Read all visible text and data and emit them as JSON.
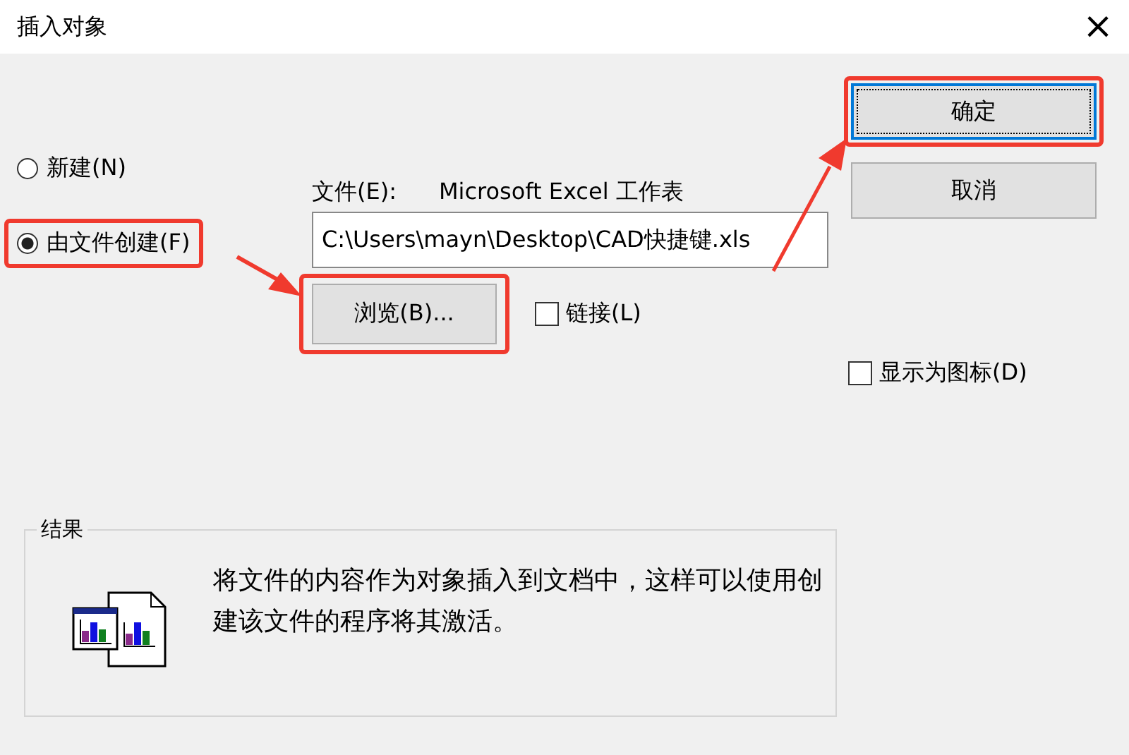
{
  "window": {
    "title": "插入对象",
    "close": "×"
  },
  "options": [
    {
      "label": "新建(N)",
      "selected": false,
      "highlighted": false
    },
    {
      "label": "由文件创建(F)",
      "selected": true,
      "highlighted": true
    }
  ],
  "file": {
    "label": "文件(E):",
    "type": "Microsoft Excel 工作表",
    "value": "C:\\Users\\mayn\\Desktop\\CAD快捷键.xls"
  },
  "browse": {
    "label": "浏览(B)...",
    "highlighted": true
  },
  "link": {
    "label": "链接(L)",
    "checked": false
  },
  "buttons": [
    {
      "label": "确定",
      "default": true,
      "highlighted": true
    },
    {
      "label": "取消",
      "default": false,
      "highlighted": false
    }
  ],
  "display_as_icon": {
    "label": "显示为图标(D)",
    "checked": false
  },
  "result": {
    "title": "结果",
    "text": "将文件的内容作为对象插入到文档中，这样可以使用创建该文件的程序将其激活。"
  }
}
